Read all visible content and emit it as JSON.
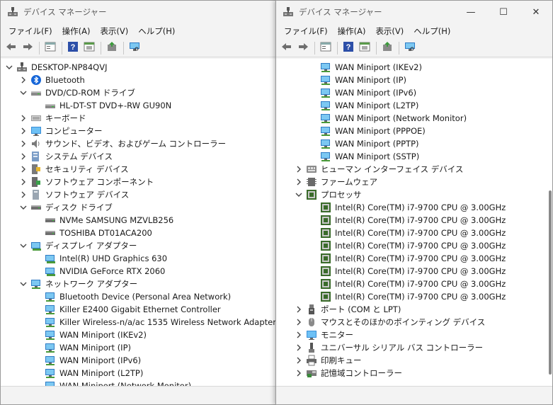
{
  "left_window": {
    "title": "デバイス マネージャー",
    "menu": [
      "ファイル(F)",
      "操作(A)",
      "表示(V)",
      "ヘルプ(H)"
    ],
    "tree": [
      {
        "label": "DESKTOP-NP84QVJ",
        "level": 0,
        "chevron": "down",
        "icon": "computer-root-icon"
      },
      {
        "label": "Bluetooth",
        "level": 1,
        "chevron": "right",
        "icon": "bluetooth-icon"
      },
      {
        "label": "DVD/CD-ROM ドライブ",
        "level": 1,
        "chevron": "down",
        "icon": "dvd-drive-icon"
      },
      {
        "label": "HL-DT-ST DVD+-RW GU90N",
        "level": 2,
        "chevron": "",
        "icon": "dvd-drive-icon"
      },
      {
        "label": "キーボード",
        "level": 1,
        "chevron": "right",
        "icon": "keyboard-icon"
      },
      {
        "label": "コンピューター",
        "level": 1,
        "chevron": "right",
        "icon": "monitor-icon"
      },
      {
        "label": "サウンド、ビデオ、およびゲーム コントローラー",
        "level": 1,
        "chevron": "right",
        "icon": "speaker-icon"
      },
      {
        "label": "システム デバイス",
        "level": 1,
        "chevron": "right",
        "icon": "system-device-icon"
      },
      {
        "label": "セキュリティ デバイス",
        "level": 1,
        "chevron": "right",
        "icon": "security-device-icon"
      },
      {
        "label": "ソフトウェア コンポーネント",
        "level": 1,
        "chevron": "right",
        "icon": "software-component-icon"
      },
      {
        "label": "ソフトウェア デバイス",
        "level": 1,
        "chevron": "right",
        "icon": "software-device-icon"
      },
      {
        "label": "ディスク ドライブ",
        "level": 1,
        "chevron": "down",
        "icon": "disk-drive-icon"
      },
      {
        "label": "NVMe SAMSUNG MZVLB256",
        "level": 2,
        "chevron": "",
        "icon": "disk-drive-icon"
      },
      {
        "label": "TOSHIBA DT01ACA200",
        "level": 2,
        "chevron": "",
        "icon": "disk-drive-icon"
      },
      {
        "label": "ディスプレイ アダプター",
        "level": 1,
        "chevron": "down",
        "icon": "display-adapter-icon"
      },
      {
        "label": "Intel(R) UHD Graphics 630",
        "level": 2,
        "chevron": "",
        "icon": "display-adapter-icon"
      },
      {
        "label": "NVIDIA GeForce RTX 2060",
        "level": 2,
        "chevron": "",
        "icon": "display-adapter-icon"
      },
      {
        "label": "ネットワーク アダプター",
        "level": 1,
        "chevron": "down",
        "icon": "network-adapter-icon"
      },
      {
        "label": "Bluetooth Device (Personal Area Network)",
        "level": 2,
        "chevron": "",
        "icon": "network-adapter-icon"
      },
      {
        "label": "Killer E2400 Gigabit Ethernet Controller",
        "level": 2,
        "chevron": "",
        "icon": "network-adapter-icon"
      },
      {
        "label": "Killer Wireless-n/a/ac 1535 Wireless Network Adapter",
        "level": 2,
        "chevron": "",
        "icon": "network-adapter-icon"
      },
      {
        "label": "WAN Miniport (IKEv2)",
        "level": 2,
        "chevron": "",
        "icon": "network-adapter-icon"
      },
      {
        "label": "WAN Miniport (IP)",
        "level": 2,
        "chevron": "",
        "icon": "network-adapter-icon"
      },
      {
        "label": "WAN Miniport (IPv6)",
        "level": 2,
        "chevron": "",
        "icon": "network-adapter-icon"
      },
      {
        "label": "WAN Miniport (L2TP)",
        "level": 2,
        "chevron": "",
        "icon": "network-adapter-icon"
      },
      {
        "label": "WAN Miniport (Network Monitor)",
        "level": 2,
        "chevron": "",
        "icon": "network-adapter-icon"
      }
    ]
  },
  "right_window": {
    "title": "デバイス マネージャー",
    "menu": [
      "ファイル(F)",
      "操作(A)",
      "表示(V)",
      "ヘルプ(H)"
    ],
    "controls": {
      "minimize": "—",
      "maximize": "☐",
      "close": "✕"
    },
    "tree": [
      {
        "label": "WAN Miniport (IKEv2)",
        "level": 2,
        "chevron": "",
        "icon": "network-adapter-icon"
      },
      {
        "label": "WAN Miniport (IP)",
        "level": 2,
        "chevron": "",
        "icon": "network-adapter-icon"
      },
      {
        "label": "WAN Miniport (IPv6)",
        "level": 2,
        "chevron": "",
        "icon": "network-adapter-icon"
      },
      {
        "label": "WAN Miniport (L2TP)",
        "level": 2,
        "chevron": "",
        "icon": "network-adapter-icon"
      },
      {
        "label": "WAN Miniport (Network Monitor)",
        "level": 2,
        "chevron": "",
        "icon": "network-adapter-icon"
      },
      {
        "label": "WAN Miniport (PPPOE)",
        "level": 2,
        "chevron": "",
        "icon": "network-adapter-icon"
      },
      {
        "label": "WAN Miniport (PPTP)",
        "level": 2,
        "chevron": "",
        "icon": "network-adapter-icon"
      },
      {
        "label": "WAN Miniport (SSTP)",
        "level": 2,
        "chevron": "",
        "icon": "network-adapter-icon"
      },
      {
        "label": "ヒューマン インターフェイス デバイス",
        "level": 1,
        "chevron": "right",
        "icon": "hid-icon"
      },
      {
        "label": "ファームウェア",
        "level": 1,
        "chevron": "right",
        "icon": "firmware-icon"
      },
      {
        "label": "プロセッサ",
        "level": 1,
        "chevron": "down",
        "icon": "processor-icon"
      },
      {
        "label": "Intel(R) Core(TM) i7-9700 CPU @ 3.00GHz",
        "level": 2,
        "chevron": "",
        "icon": "processor-icon"
      },
      {
        "label": "Intel(R) Core(TM) i7-9700 CPU @ 3.00GHz",
        "level": 2,
        "chevron": "",
        "icon": "processor-icon"
      },
      {
        "label": "Intel(R) Core(TM) i7-9700 CPU @ 3.00GHz",
        "level": 2,
        "chevron": "",
        "icon": "processor-icon"
      },
      {
        "label": "Intel(R) Core(TM) i7-9700 CPU @ 3.00GHz",
        "level": 2,
        "chevron": "",
        "icon": "processor-icon"
      },
      {
        "label": "Intel(R) Core(TM) i7-9700 CPU @ 3.00GHz",
        "level": 2,
        "chevron": "",
        "icon": "processor-icon"
      },
      {
        "label": "Intel(R) Core(TM) i7-9700 CPU @ 3.00GHz",
        "level": 2,
        "chevron": "",
        "icon": "processor-icon"
      },
      {
        "label": "Intel(R) Core(TM) i7-9700 CPU @ 3.00GHz",
        "level": 2,
        "chevron": "",
        "icon": "processor-icon"
      },
      {
        "label": "Intel(R) Core(TM) i7-9700 CPU @ 3.00GHz",
        "level": 2,
        "chevron": "",
        "icon": "processor-icon"
      },
      {
        "label": "ポート (COM と LPT)",
        "level": 1,
        "chevron": "right",
        "icon": "port-icon"
      },
      {
        "label": "マウスとそのほかのポインティング デバイス",
        "level": 1,
        "chevron": "right",
        "icon": "mouse-icon"
      },
      {
        "label": "モニター",
        "level": 1,
        "chevron": "right",
        "icon": "monitor-icon"
      },
      {
        "label": "ユニバーサル シリアル バス コントローラー",
        "level": 1,
        "chevron": "right",
        "icon": "usb-icon"
      },
      {
        "label": "印刷キュー",
        "level": 1,
        "chevron": "right",
        "icon": "printer-icon"
      },
      {
        "label": "記憶域コントローラー",
        "level": 1,
        "chevron": "right",
        "icon": "storage-controller-icon"
      }
    ]
  },
  "toolbar_icons": [
    "back-arrow-icon",
    "forward-arrow-icon",
    "properties-icon",
    "help-icon",
    "action-view-icon",
    "update-driver-icon",
    "scan-hardware-icon"
  ]
}
